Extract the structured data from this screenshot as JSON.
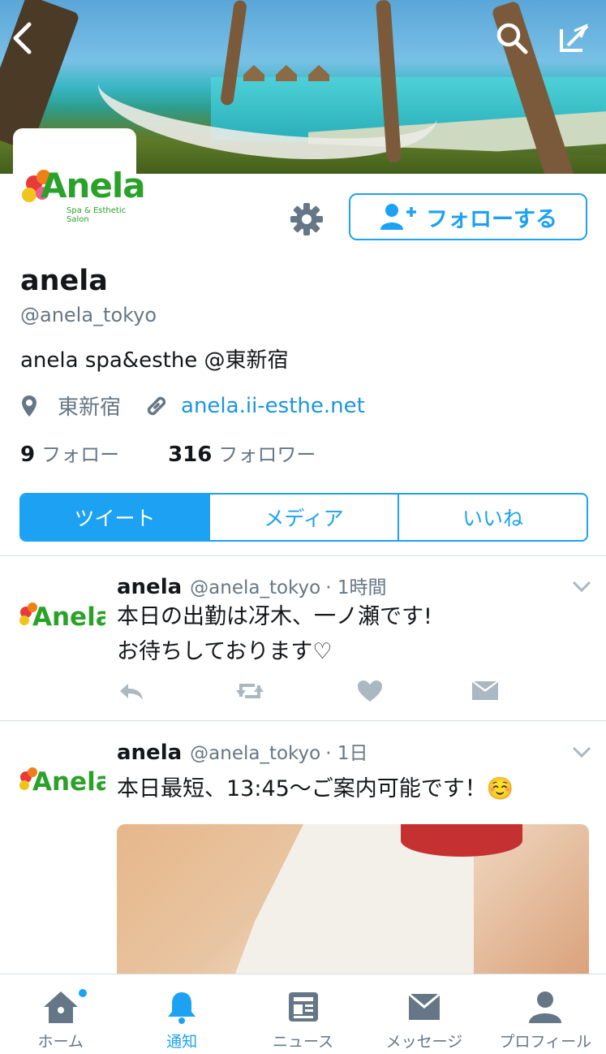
{
  "profile": {
    "name": "anela",
    "handle": "@anela_tokyo",
    "bio": "anela spa&esthe @東新宿",
    "location": "東新宿",
    "website": "anela.ii-esthe.net",
    "logo_text": "Anela",
    "logo_sub": "Spa & Esthetic Salon",
    "following_count": "9",
    "following_label": "フォロー",
    "followers_count": "316",
    "followers_label": "フォロワー"
  },
  "follow_button": "フォローする",
  "tabs": [
    "ツイート",
    "メディア",
    "いいね"
  ],
  "tweets": [
    {
      "name": "anela",
      "handle": "@anela_tokyo",
      "time": "· 1時間",
      "text_line1": "本日の出勤は冴木、一ノ瀬です!",
      "text_line2": "お待ちしております♡"
    },
    {
      "name": "anela",
      "handle": "@anela_tokyo",
      "time": "· 1日",
      "text_line1": "本日最短、13:45〜ご案内可能です！☺️"
    }
  ],
  "nav": [
    {
      "label": "ホーム",
      "icon": "home-icon"
    },
    {
      "label": "通知",
      "icon": "bell-icon"
    },
    {
      "label": "ニュース",
      "icon": "news-icon"
    },
    {
      "label": "メッセージ",
      "icon": "envelope-icon"
    },
    {
      "label": "プロフィール",
      "icon": "person-icon"
    }
  ],
  "colors": {
    "accent": "#1da1f2",
    "secondary_text": "#657786",
    "logo_green": "#2aa22a"
  }
}
